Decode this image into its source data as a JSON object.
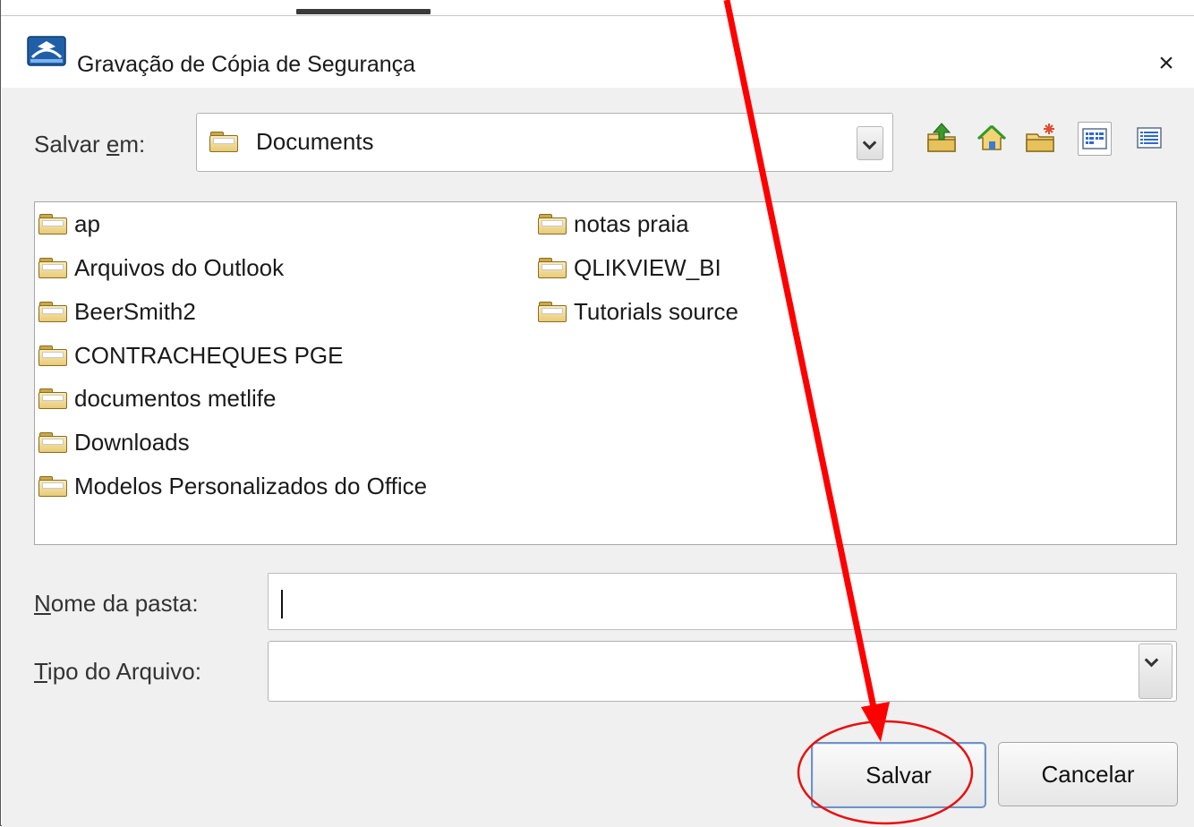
{
  "dialog": {
    "title": "Gravação de Cópia de Segurança",
    "close_symbol": "×"
  },
  "save_in": {
    "label_prefix": "Salvar ",
    "label_accel": "e",
    "label_suffix": "m:",
    "value": "Documents"
  },
  "toolbar": {
    "icons": [
      "up-one-level-icon",
      "home-icon",
      "new-folder-icon",
      "list-view-icon",
      "details-view-icon"
    ],
    "selected_view": "list-view-icon"
  },
  "files": {
    "column_1": [
      "ap",
      "Arquivos do Outlook",
      "BeerSmith2",
      "CONTRACHEQUES PGE",
      "documentos metlife",
      "Downloads",
      "Modelos Personalizados do Office"
    ],
    "column_2": [
      "notas praia",
      "QLIKVIEW_BI",
      "Tutorials source"
    ]
  },
  "folder_name": {
    "label_accel": "N",
    "label_rest": "ome da pasta:",
    "value": ""
  },
  "file_type": {
    "label_accel": "T",
    "label_rest": "ipo do Arquivo:",
    "value": ""
  },
  "buttons": {
    "save": "Salvar",
    "cancel": "Cancelar"
  },
  "annotation": {
    "color": "#ff0000",
    "description_target": "save-button"
  }
}
